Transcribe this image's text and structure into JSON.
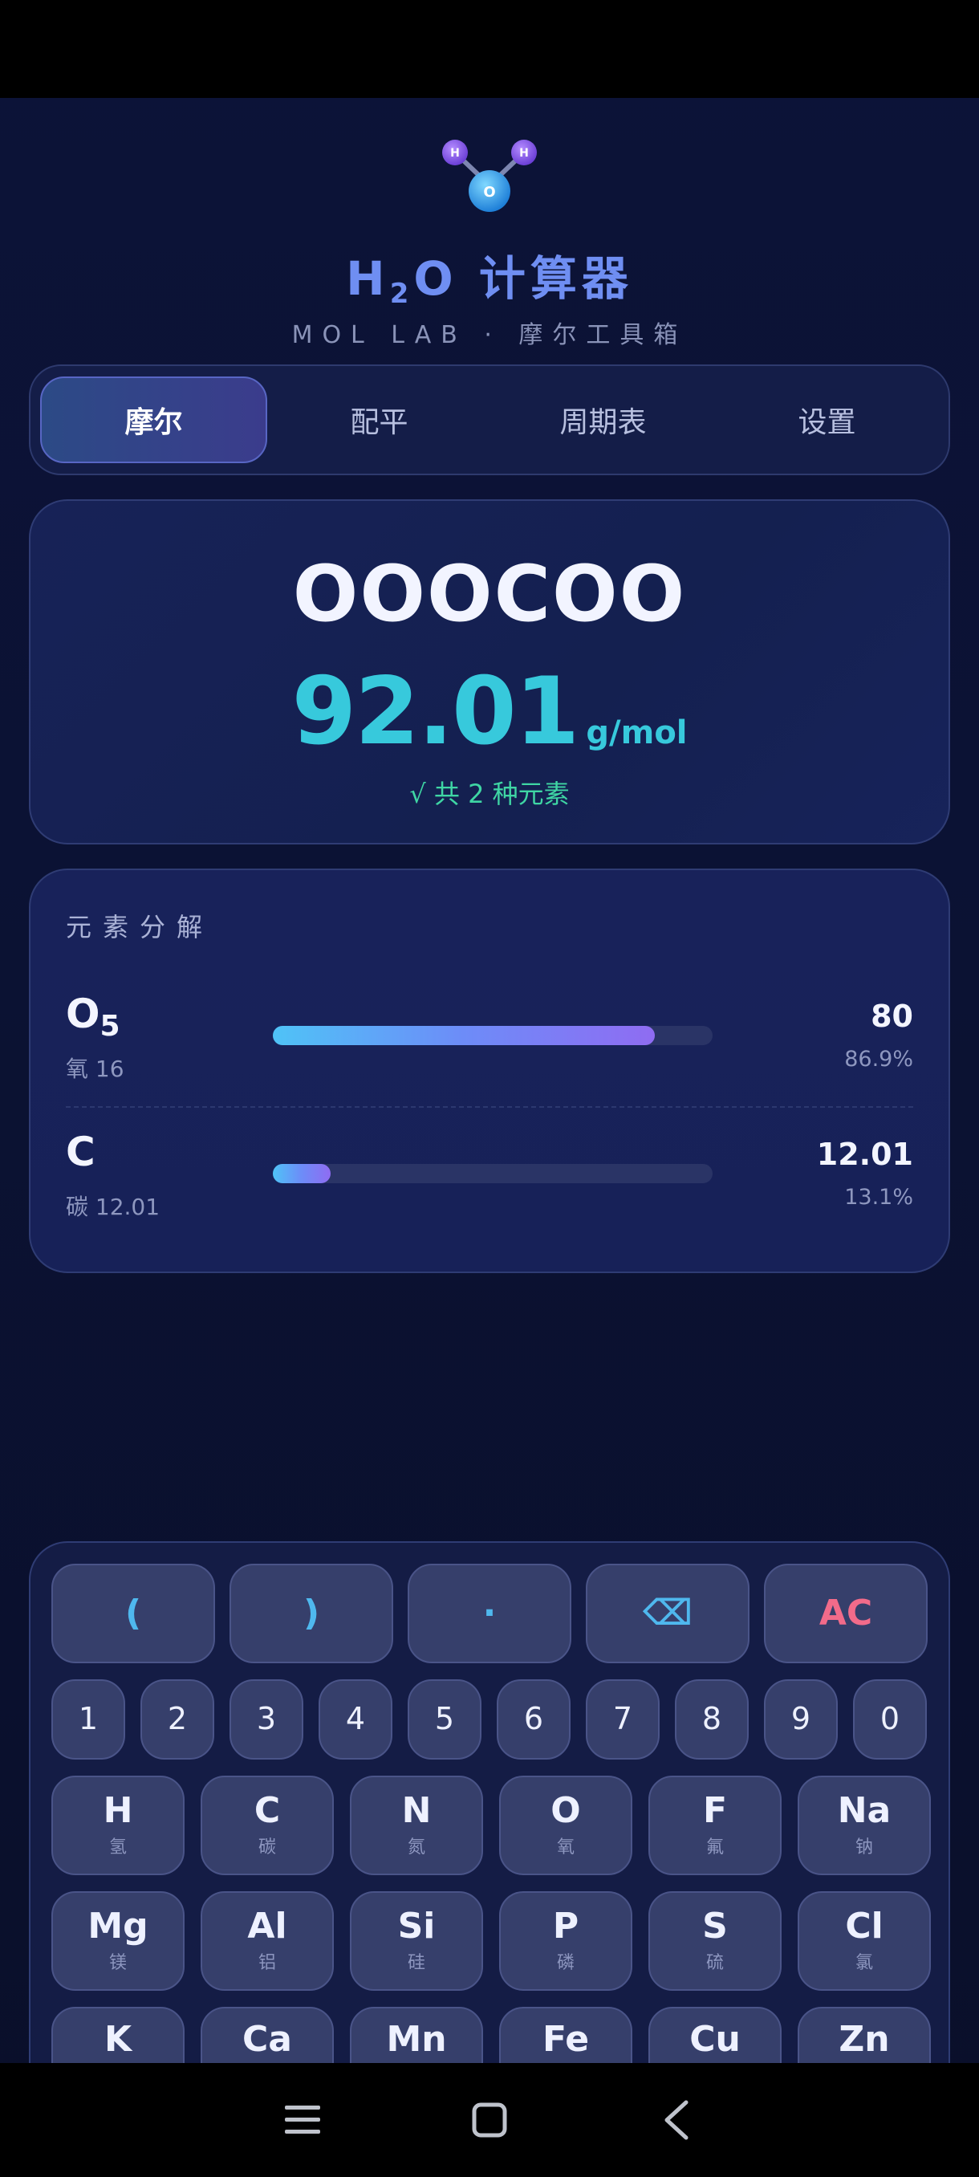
{
  "header": {
    "title_main": "H",
    "title_sub": "2",
    "title_rest": "O 计算器",
    "subtitle": "MOL LAB · 摩尔工具箱",
    "logo_labels": {
      "h1": "H",
      "h2": "H",
      "o": "O"
    }
  },
  "tabs": [
    {
      "label": "摩尔",
      "active": true
    },
    {
      "label": "配平",
      "active": false
    },
    {
      "label": "周期表",
      "active": false
    },
    {
      "label": "设置",
      "active": false
    }
  ],
  "result": {
    "formula": "OOOCOO",
    "mass_value": "92.01",
    "mass_unit": "g/mol",
    "elements_count": "√ 共 2 种元素"
  },
  "breakdown": {
    "title": "元素分解",
    "rows": [
      {
        "symbol": "O",
        "subscript": "5",
        "name": "氧 16",
        "mass": "80",
        "percent": "86.9%",
        "fraction": 0.869
      },
      {
        "symbol": "C",
        "subscript": "",
        "name": "碳 12.01",
        "mass": "12.01",
        "percent": "13.1%",
        "fraction": 0.131
      }
    ]
  },
  "keypad": {
    "symbols": [
      {
        "label": "(",
        "kind": "sym"
      },
      {
        "label": ")",
        "kind": "sym"
      },
      {
        "label": "·",
        "kind": "sym"
      },
      {
        "label": "⌫",
        "kind": "sym"
      },
      {
        "label": "AC",
        "kind": "ac"
      }
    ],
    "numbers": [
      "1",
      "2",
      "3",
      "4",
      "5",
      "6",
      "7",
      "8",
      "9",
      "0"
    ],
    "elements_row1": [
      {
        "symbol": "H",
        "cn": "氢"
      },
      {
        "symbol": "C",
        "cn": "碳"
      },
      {
        "symbol": "N",
        "cn": "氮"
      },
      {
        "symbol": "O",
        "cn": "氧"
      },
      {
        "symbol": "F",
        "cn": "氟"
      },
      {
        "symbol": "Na",
        "cn": "钠"
      }
    ],
    "elements_row2": [
      {
        "symbol": "Mg",
        "cn": "镁"
      },
      {
        "symbol": "Al",
        "cn": "铝"
      },
      {
        "symbol": "Si",
        "cn": "硅"
      },
      {
        "symbol": "P",
        "cn": "磷"
      },
      {
        "symbol": "S",
        "cn": "硫"
      },
      {
        "symbol": "Cl",
        "cn": "氯"
      }
    ],
    "elements_row3": [
      {
        "symbol": "K"
      },
      {
        "symbol": "Ca"
      },
      {
        "symbol": "Mn"
      },
      {
        "symbol": "Fe"
      },
      {
        "symbol": "Cu"
      },
      {
        "symbol": "Zn"
      }
    ]
  },
  "nav": {
    "icons": [
      "menu-icon",
      "home-icon",
      "back-icon"
    ]
  },
  "colors": {
    "accent_cyan": "#37c9dc",
    "accent_green": "#3fd6a4",
    "accent_red": "#f26b8a",
    "title_blue": "#6f8ef2"
  }
}
